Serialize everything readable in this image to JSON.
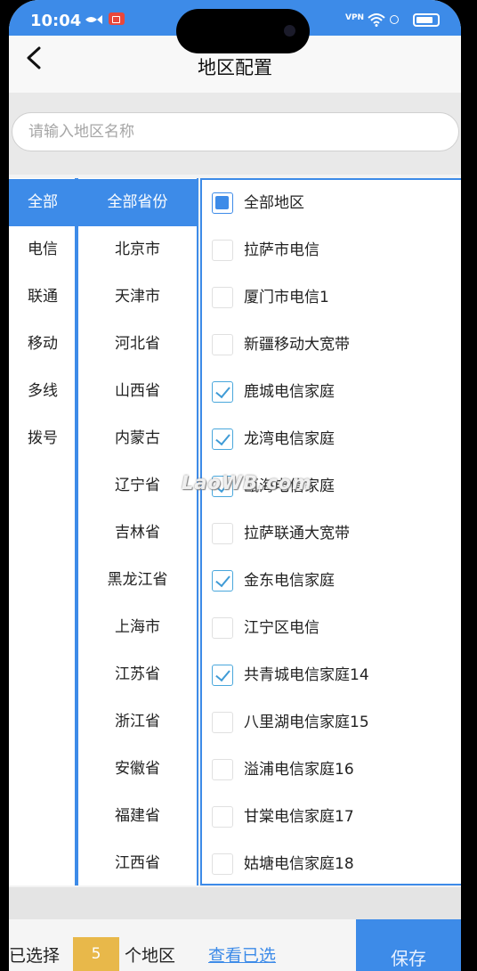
{
  "status_bar": {
    "time": "10:04",
    "vpn": "VPN"
  },
  "header": {
    "title": "地区配置"
  },
  "search": {
    "placeholder": "请输入地区名称"
  },
  "carriers": [
    "全部",
    "电信",
    "联通",
    "移动",
    "多线",
    "拨号"
  ],
  "provinces": [
    "全部省份",
    "北京市",
    "天津市",
    "河北省",
    "山西省",
    "内蒙古",
    "辽宁省",
    "吉林省",
    "黑龙江省",
    "上海市",
    "江苏省",
    "浙江省",
    "安徽省",
    "福建省",
    "江西省"
  ],
  "areas": [
    {
      "label": "全部地区",
      "state": "all"
    },
    {
      "label": "拉萨市电信",
      "state": "unchecked"
    },
    {
      "label": "厦门市电信1",
      "state": "unchecked"
    },
    {
      "label": "新疆移动大宽带",
      "state": "unchecked"
    },
    {
      "label": "鹿城电信家庭",
      "state": "checked"
    },
    {
      "label": "龙湾电信家庭",
      "state": "checked"
    },
    {
      "label": "瓯海电信家庭",
      "state": "checked"
    },
    {
      "label": "拉萨联通大宽带",
      "state": "unchecked"
    },
    {
      "label": "金东电信家庭",
      "state": "checked"
    },
    {
      "label": "江宁区电信",
      "state": "unchecked"
    },
    {
      "label": "共青城电信家庭14",
      "state": "checked"
    },
    {
      "label": "八里湖电信家庭15",
      "state": "unchecked"
    },
    {
      "label": "溢浦电信家庭16",
      "state": "unchecked"
    },
    {
      "label": "甘棠电信家庭17",
      "state": "unchecked"
    },
    {
      "label": "姑塘电信家庭18",
      "state": "unchecked"
    }
  ],
  "watermark": "LaoWB.com",
  "footer": {
    "selected_prefix": "已选择",
    "selected_count": "5",
    "selected_suffix": "个地区",
    "view_selected": "查看已选",
    "save": "保存"
  },
  "colors": {
    "accent": "#3d8be8",
    "count_badge": "#e8b84a",
    "check": "#3f9bd6"
  }
}
